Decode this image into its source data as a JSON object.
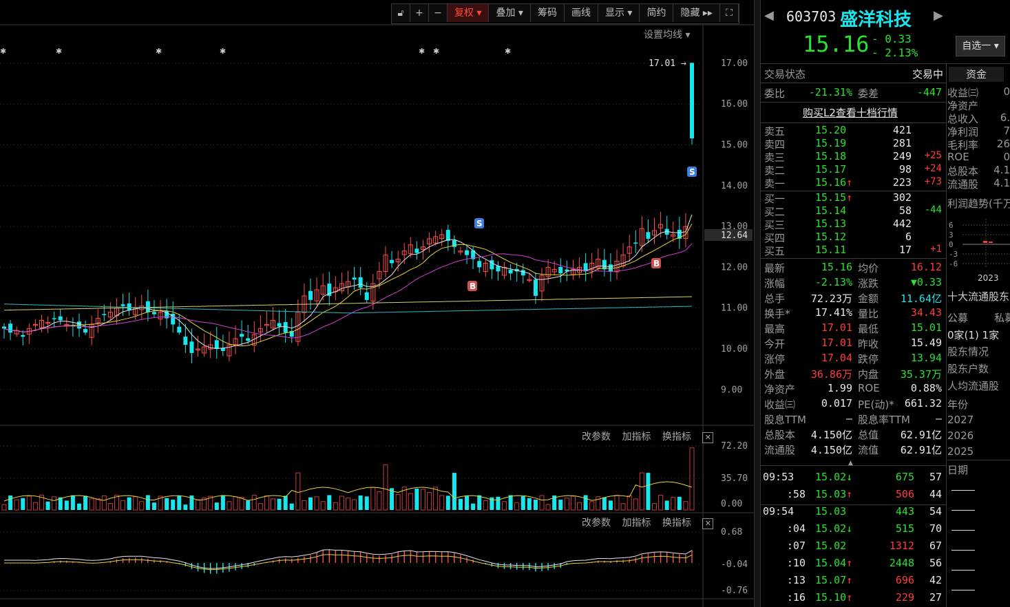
{
  "toolbar": {
    "items": [
      "复权",
      "叠加",
      "筹码",
      "画线",
      "显示",
      "简约",
      "隐藏"
    ],
    "active": "复权"
  },
  "main_chart": {
    "ma_setting_label": "设置均线",
    "high_marker": "17.01",
    "current_price_tag": "12.64",
    "y_ticks": [
      "17.00",
      "16.00",
      "15.00",
      "14.00",
      "13.00",
      "12.00",
      "11.00",
      "10.00",
      "9.00"
    ],
    "signals": [
      "S",
      "B",
      "S",
      "B"
    ]
  },
  "volume_panel": {
    "actions": [
      "改参数",
      "加指标",
      "换指标"
    ],
    "y_ticks": [
      "72.20",
      "35.70",
      "0.00"
    ]
  },
  "macd_panel": {
    "actions": [
      "改参数",
      "加指标",
      "换指标"
    ],
    "y_ticks": [
      "0.68",
      "-0.04",
      "-0.76"
    ]
  },
  "header": {
    "code": "603703",
    "name": "盛洋科技",
    "price": "15.16",
    "change": "- 0.33",
    "change_pct": "- 2.13%",
    "watchlist_btn": "自选一"
  },
  "status": {
    "label": "交易状态",
    "value": "交易中"
  },
  "weibi": {
    "label": "委比",
    "value": "-21.31%",
    "label2": "委差",
    "value2": "-447"
  },
  "l2_link": "购买L2查看十档行情",
  "asks": [
    {
      "label": "卖五",
      "price": "15.20",
      "vol": "421",
      "delta": ""
    },
    {
      "label": "卖四",
      "price": "15.19",
      "vol": "281",
      "delta": ""
    },
    {
      "label": "卖三",
      "price": "15.18",
      "vol": "249",
      "delta": "+25"
    },
    {
      "label": "卖二",
      "price": "15.17",
      "vol": "98",
      "delta": "+24"
    },
    {
      "label": "卖一",
      "price": "15.16",
      "vol": "223",
      "delta": "+73",
      "arrow": "↑"
    }
  ],
  "bids": [
    {
      "label": "买一",
      "price": "15.15",
      "vol": "302",
      "delta": "",
      "arrow": "↑"
    },
    {
      "label": "买二",
      "price": "15.14",
      "vol": "58",
      "delta": "-44"
    },
    {
      "label": "买三",
      "price": "15.13",
      "vol": "442",
      "delta": ""
    },
    {
      "label": "买四",
      "price": "15.12",
      "vol": "6",
      "delta": ""
    },
    {
      "label": "买五",
      "price": "15.11",
      "vol": "17",
      "delta": "+1"
    }
  ],
  "quote": [
    {
      "l1": "最新",
      "v1": "15.16",
      "c1": "green",
      "l2": "均价",
      "v2": "16.12",
      "c2": "red"
    },
    {
      "l1": "涨幅",
      "v1": "-2.13%",
      "c1": "green",
      "l2": "涨跌",
      "v2": "▼0.33",
      "c2": "green"
    },
    {
      "l1": "总手",
      "v1": "72.23万",
      "c1": "white",
      "l2": "金额",
      "v2": "11.64亿",
      "c2": "cyan"
    },
    {
      "l1": "换手*",
      "v1": "17.41%",
      "c1": "white",
      "l2": "量比",
      "v2": "34.43",
      "c2": "red"
    },
    {
      "l1": "最高",
      "v1": "17.01",
      "c1": "red",
      "l2": "最低",
      "v2": "15.01",
      "c2": "green"
    },
    {
      "l1": "今开",
      "v1": "17.01",
      "c1": "red",
      "l2": "昨收",
      "v2": "15.49",
      "c2": "white"
    },
    {
      "l1": "涨停",
      "v1": "17.04",
      "c1": "red",
      "l2": "跌停",
      "v2": "13.94",
      "c2": "green"
    },
    {
      "l1": "外盘",
      "v1": "36.86万",
      "c1": "red",
      "l2": "内盘",
      "v2": "35.37万",
      "c2": "green"
    },
    {
      "l1": "净资产",
      "v1": "1.99",
      "c1": "white",
      "l2": "ROE",
      "v2": "0.88%",
      "c2": "white"
    },
    {
      "l1": "收益㈢",
      "v1": "0.017",
      "c1": "white",
      "l2": "PE(动)*",
      "v2": "661.32",
      "c2": "white"
    },
    {
      "l1": "股息TTM",
      "v1": "—",
      "c1": "white",
      "l2": "股息率TTM",
      "v2": "—",
      "c2": "white"
    },
    {
      "l1": "总股本",
      "v1": "4.150亿",
      "c1": "white",
      "l2": "总值",
      "v2": "62.91亿",
      "c2": "white"
    },
    {
      "l1": "流通股",
      "v1": "4.150亿",
      "c1": "white",
      "l2": "流值",
      "v2": "62.91亿",
      "c2": "white"
    }
  ],
  "ticks": [
    {
      "time": "09:53",
      "price": "15.02",
      "pc": "green",
      "arrow": "↓",
      "vol": "675",
      "vc": "green",
      "n": "57"
    },
    {
      "time": ":58",
      "price": "15.03",
      "pc": "green",
      "arrow": "↑",
      "vol": "506",
      "vc": "red",
      "n": "44"
    },
    {
      "time": "09:54",
      "price": "15.03",
      "pc": "green",
      "arrow": "",
      "vol": "443",
      "vc": "green",
      "n": "54"
    },
    {
      "time": ":04",
      "price": "15.02",
      "pc": "green",
      "arrow": "↓",
      "vol": "515",
      "vc": "green",
      "n": "70"
    },
    {
      "time": ":07",
      "price": "15.02",
      "pc": "green",
      "arrow": "",
      "vol": "1312",
      "vc": "red",
      "n": "67"
    },
    {
      "time": ":10",
      "price": "15.04",
      "pc": "green",
      "arrow": "↑",
      "vol": "2448",
      "vc": "green",
      "n": "56"
    },
    {
      "time": ":13",
      "price": "15.07",
      "pc": "green",
      "arrow": "↑",
      "vol": "696",
      "vc": "red",
      "n": "42"
    },
    {
      "time": ":16",
      "price": "15.10",
      "pc": "green",
      "arrow": "↑",
      "vol": "229",
      "vc": "red",
      "n": "27"
    }
  ],
  "sidebar": {
    "tab": "资金",
    "fin_items": [
      {
        "label": "收益㈢",
        "val": "0"
      },
      {
        "label": "净资产",
        "val": ""
      },
      {
        "label": "总收入",
        "val": "6."
      },
      {
        "label": "净利润",
        "val": "7"
      },
      {
        "label": "毛利率",
        "val": "26"
      },
      {
        "label": "ROE",
        "val": "0"
      },
      {
        "label": "总股本",
        "val": "4.1"
      },
      {
        "label": "流通股",
        "val": "4.1"
      }
    ],
    "profit_trend": "利润趋势(千万",
    "mini_y": [
      "6",
      "3",
      "0",
      "-3",
      "-6"
    ],
    "mini_year": "2023",
    "top10": "十大流通股东",
    "holder_cols": [
      "公募",
      "私募"
    ],
    "holder_vals": "0家(1)  1家",
    "links": [
      "股东情况",
      "股东户数",
      "人均流通股"
    ],
    "year_header": "年份",
    "years": [
      "2027",
      "2026",
      "2025"
    ],
    "date_header": "日期"
  }
}
